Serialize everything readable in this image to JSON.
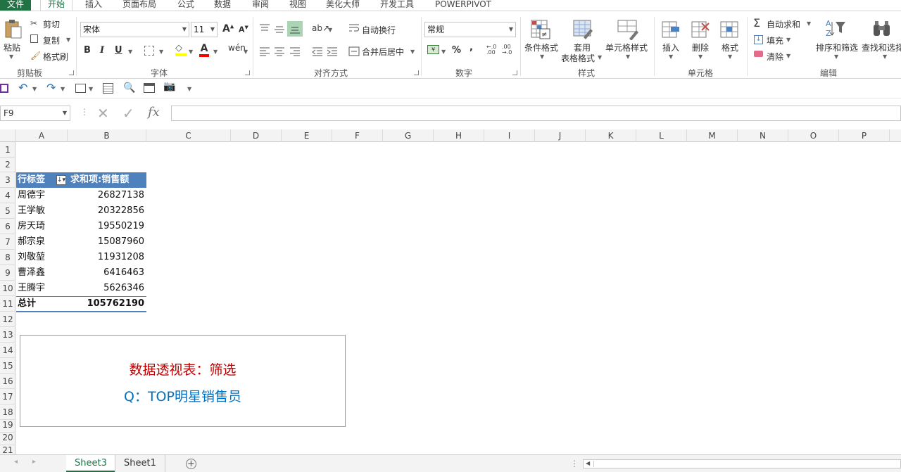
{
  "ribbon_tabs": [
    "文件",
    "开始",
    "插入",
    "页面布局",
    "公式",
    "数据",
    "审阅",
    "视图",
    "美化大师",
    "开发工具",
    "POWERPIVOT"
  ],
  "active_tab": "开始",
  "clipboard": {
    "paste": "粘贴",
    "cut": "剪切",
    "copy": "复制",
    "format_painter": "格式刷",
    "group": "剪贴板"
  },
  "font": {
    "name": "宋体",
    "size": "11",
    "bold": "B",
    "italic": "I",
    "underline": "U",
    "group": "字体"
  },
  "alignment": {
    "wrap": "自动换行",
    "merge": "合并后居中",
    "group": "对齐方式"
  },
  "number": {
    "format": "常规",
    "percent": "%",
    "comma": ",",
    "group": "数字"
  },
  "styles": {
    "conditional": "条件格式",
    "table_format_1": "套用",
    "table_format_2": "表格格式",
    "cell_styles": "单元格样式",
    "group": "样式"
  },
  "cells_group": {
    "insert": "插入",
    "delete": "删除",
    "format": "格式",
    "group": "单元格"
  },
  "editing": {
    "autosum": "自动求和",
    "fill": "填充",
    "clear": "清除",
    "sort_filter": "排序和筛选",
    "find_select": "查找和选择",
    "group": "编辑"
  },
  "namebox": "F9",
  "formula_icon": "fx",
  "columns": [
    "A",
    "B",
    "C",
    "D",
    "E",
    "F",
    "G",
    "H",
    "I",
    "J",
    "K",
    "L",
    "M",
    "N",
    "O",
    "P"
  ],
  "rows": [
    "1",
    "2",
    "3",
    "4",
    "5",
    "6",
    "7",
    "8",
    "9",
    "10",
    "11",
    "12",
    "13",
    "14",
    "15",
    "16",
    "17",
    "18",
    "19",
    "20",
    "21"
  ],
  "pivot": {
    "row_label_header": "行标签",
    "value_header": "求和项:销售额",
    "rows": [
      {
        "name": "周德宇",
        "value": "26827138"
      },
      {
        "name": "王学敏",
        "value": "20322856"
      },
      {
        "name": "房天琦",
        "value": "19550219"
      },
      {
        "name": "郝宗泉",
        "value": "15087960"
      },
      {
        "name": "刘敬堃",
        "value": "11931208"
      },
      {
        "name": "曹泽鑫",
        "value": "6416463"
      },
      {
        "name": "王腾宇",
        "value": "5626346"
      }
    ],
    "total_label": "总计",
    "total_value": "105762190"
  },
  "textbox": {
    "line1": "数据透视表：筛选",
    "line2": "Q：TOP明星销售员"
  },
  "sheets": [
    "Sheet3",
    "Sheet1"
  ],
  "active_sheet": "Sheet3",
  "colors": {
    "excel_green": "#217346",
    "pivot_header": "#4f81bd",
    "red_text": "#c00000",
    "blue_text": "#0070c0"
  }
}
